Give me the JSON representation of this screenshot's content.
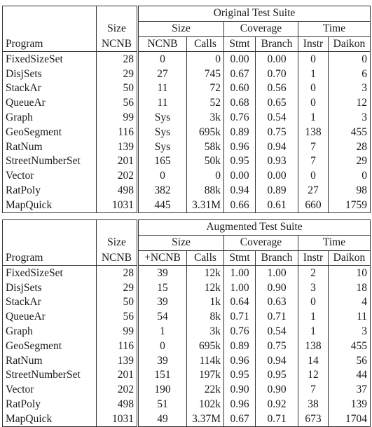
{
  "tables": [
    {
      "title": "Original Test Suite",
      "headers": {
        "program": "Program",
        "size_top": "Size",
        "size_bottom": "NCNB",
        "group_size": "Size",
        "group_coverage": "Coverage",
        "group_time": "Time",
        "ncnb": "NCNB",
        "calls": "Calls",
        "stmt": "Stmt",
        "branch": "Branch",
        "instr": "Instr",
        "daikon": "Daikon"
      },
      "rows": [
        {
          "program": "FixedSizeSet",
          "size": "28",
          "ncnb": "0",
          "calls": "0",
          "stmt": "0.00",
          "branch": "0.00",
          "instr": "0",
          "daikon": "0"
        },
        {
          "program": "DisjSets",
          "size": "29",
          "ncnb": "27",
          "calls": "745",
          "stmt": "0.67",
          "branch": "0.70",
          "instr": "1",
          "daikon": "6"
        },
        {
          "program": "StackAr",
          "size": "50",
          "ncnb": "11",
          "calls": "72",
          "stmt": "0.60",
          "branch": "0.56",
          "instr": "0",
          "daikon": "3"
        },
        {
          "program": "QueueAr",
          "size": "56",
          "ncnb": "11",
          "calls": "52",
          "stmt": "0.68",
          "branch": "0.65",
          "instr": "0",
          "daikon": "12"
        },
        {
          "program": "Graph",
          "size": "99",
          "ncnb": "Sys",
          "calls": "3k",
          "stmt": "0.76",
          "branch": "0.54",
          "instr": "1",
          "daikon": "3"
        },
        {
          "program": "GeoSegment",
          "size": "116",
          "ncnb": "Sys",
          "calls": "695k",
          "stmt": "0.89",
          "branch": "0.75",
          "instr": "138",
          "daikon": "455"
        },
        {
          "program": "RatNum",
          "size": "139",
          "ncnb": "Sys",
          "calls": "58k",
          "stmt": "0.96",
          "branch": "0.94",
          "instr": "7",
          "daikon": "28"
        },
        {
          "program": "StreetNumberSet",
          "size": "201",
          "ncnb": "165",
          "calls": "50k",
          "stmt": "0.95",
          "branch": "0.93",
          "instr": "7",
          "daikon": "29"
        },
        {
          "program": "Vector",
          "size": "202",
          "ncnb": "0",
          "calls": "0",
          "stmt": "0.00",
          "branch": "0.00",
          "instr": "0",
          "daikon": "0"
        },
        {
          "program": "RatPoly",
          "size": "498",
          "ncnb": "382",
          "calls": "88k",
          "stmt": "0.94",
          "branch": "0.89",
          "instr": "27",
          "daikon": "98"
        },
        {
          "program": "MapQuick",
          "size": "1031",
          "ncnb": "445",
          "calls": "3.31M",
          "stmt": "0.66",
          "branch": "0.61",
          "instr": "660",
          "daikon": "1759"
        }
      ]
    },
    {
      "title": "Augmented Test Suite",
      "headers": {
        "program": "Program",
        "size_top": "Size",
        "size_bottom": "NCNB",
        "group_size": "Size",
        "group_coverage": "Coverage",
        "group_time": "Time",
        "ncnb": "+NCNB",
        "calls": "Calls",
        "stmt": "Stmt",
        "branch": "Branch",
        "instr": "Instr",
        "daikon": "Daikon"
      },
      "rows": [
        {
          "program": "FixedSizeSet",
          "size": "28",
          "ncnb": "39",
          "calls": "12k",
          "stmt": "1.00",
          "branch": "1.00",
          "instr": "2",
          "daikon": "10"
        },
        {
          "program": "DisjSets",
          "size": "29",
          "ncnb": "15",
          "calls": "12k",
          "stmt": "1.00",
          "branch": "0.90",
          "instr": "3",
          "daikon": "18"
        },
        {
          "program": "StackAr",
          "size": "50",
          "ncnb": "39",
          "calls": "1k",
          "stmt": "0.64",
          "branch": "0.63",
          "instr": "0",
          "daikon": "4"
        },
        {
          "program": "QueueAr",
          "size": "56",
          "ncnb": "54",
          "calls": "8k",
          "stmt": "0.71",
          "branch": "0.71",
          "instr": "1",
          "daikon": "11"
        },
        {
          "program": "Graph",
          "size": "99",
          "ncnb": "1",
          "calls": "3k",
          "stmt": "0.76",
          "branch": "0.54",
          "instr": "1",
          "daikon": "3"
        },
        {
          "program": "GeoSegment",
          "size": "116",
          "ncnb": "0",
          "calls": "695k",
          "stmt": "0.89",
          "branch": "0.75",
          "instr": "138",
          "daikon": "455"
        },
        {
          "program": "RatNum",
          "size": "139",
          "ncnb": "39",
          "calls": "114k",
          "stmt": "0.96",
          "branch": "0.94",
          "instr": "14",
          "daikon": "56"
        },
        {
          "program": "StreetNumberSet",
          "size": "201",
          "ncnb": "151",
          "calls": "197k",
          "stmt": "0.95",
          "branch": "0.95",
          "instr": "12",
          "daikon": "44"
        },
        {
          "program": "Vector",
          "size": "202",
          "ncnb": "190",
          "calls": "22k",
          "stmt": "0.90",
          "branch": "0.90",
          "instr": "7",
          "daikon": "37"
        },
        {
          "program": "RatPoly",
          "size": "498",
          "ncnb": "51",
          "calls": "102k",
          "stmt": "0.96",
          "branch": "0.92",
          "instr": "38",
          "daikon": "139"
        },
        {
          "program": "MapQuick",
          "size": "1031",
          "ncnb": "49",
          "calls": "3.37M",
          "stmt": "0.67",
          "branch": "0.71",
          "instr": "673",
          "daikon": "1704"
        }
      ]
    }
  ]
}
